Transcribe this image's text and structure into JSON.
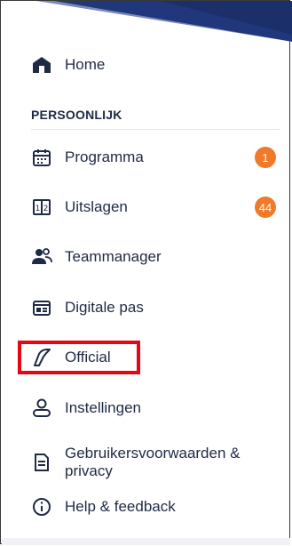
{
  "nav": {
    "home": {
      "label": "Home",
      "icon": "home-icon"
    },
    "section_title": "PERSOONLIJK",
    "items": [
      {
        "label": "Programma",
        "icon": "calendar-icon",
        "badge": "1"
      },
      {
        "label": "Uitslagen",
        "icon": "scoreboard-icon",
        "badge": "44"
      },
      {
        "label": "Teammanager",
        "icon": "team-icon"
      },
      {
        "label": "Digitale pas",
        "icon": "id-card-icon"
      },
      {
        "label": "Official",
        "icon": "whistle-icon"
      },
      {
        "label": "Instellingen",
        "icon": "user-settings-icon"
      },
      {
        "label": "Gebruikersvoorwaarden & privacy",
        "icon": "document-icon"
      },
      {
        "label": "Help & feedback",
        "icon": "info-icon"
      }
    ]
  },
  "colors": {
    "badge": "#f07a2a",
    "highlight": "#e30613",
    "text": "#1f2a44",
    "banner": "#1b2f6b"
  }
}
